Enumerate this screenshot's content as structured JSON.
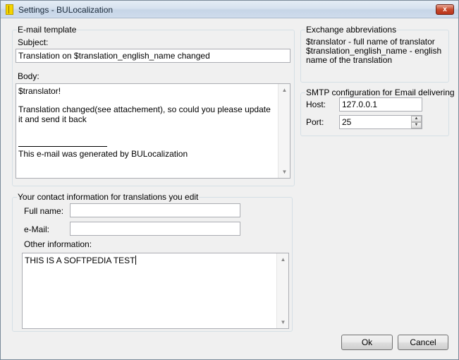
{
  "window": {
    "title": "Settings - BULocalization",
    "close_glyph": "x"
  },
  "email_template": {
    "group_label": "E-mail template",
    "subject_label": "Subject:",
    "subject_value": "Translation on $translation_english_name changed",
    "body_label": "Body:",
    "body_line1": "$translator!",
    "body_line2": "Translation changed(see attachement), so could you please update it and send it back",
    "body_footer": "This e-mail was generated by BULocalization"
  },
  "exchange": {
    "group_label": "Exchange abbreviations",
    "text": "$translator - full name of translator\n$translation_english_name - english name of the translation"
  },
  "smtp": {
    "group_label": "SMTP configuration for Email delivering",
    "host_label": "Host:",
    "host_value": "127.0.0.1",
    "port_label": "Port:",
    "port_value": "25"
  },
  "contact": {
    "group_label": "Your contact information for translations you edit",
    "full_name_label": "Full name:",
    "full_name_value": "",
    "email_label": "e-Mail:",
    "email_value": "",
    "other_label": "Other information:",
    "other_value": "THIS IS A SOFTPEDIA TEST"
  },
  "buttons": {
    "ok": "Ok",
    "cancel": "Cancel"
  }
}
